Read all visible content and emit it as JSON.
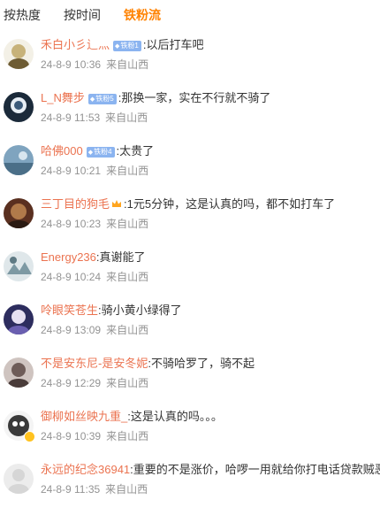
{
  "tabs": [
    {
      "label": "按热度",
      "active": false
    },
    {
      "label": "按时间",
      "active": false
    },
    {
      "label": "铁粉流",
      "active": true
    }
  ],
  "comments": [
    {
      "user": "禾白小彡辶灬",
      "badge": "铁粉1",
      "text": "以后打车吧",
      "time": "24-8-9 10:36",
      "location": "来自山西",
      "avatar_color": "#8a7a54"
    },
    {
      "user": "L_N舞步",
      "badge": "铁粉5",
      "text": "那换一家，实在不行就不骑了",
      "time": "24-8-9 11:53",
      "location": "来自山西",
      "avatar_color": "#203448"
    },
    {
      "user": "哈佛000",
      "badge": "铁粉4",
      "text": "太贵了",
      "time": "24-8-9 10:21",
      "location": "来自山西",
      "avatar_color": "#6a8fa8"
    },
    {
      "user": "三丁目的狗毛",
      "badge": "",
      "text": "1元5分钟，这是认真的吗，都不如打车了",
      "time": "24-8-9 10:23",
      "location": "来自山西",
      "avatar_color": "#8a4a2a"
    },
    {
      "user": "Energy236",
      "badge": "",
      "text": "真谢能了",
      "time": "24-8-9 10:24",
      "location": "来自山西",
      "avatar_color": "#9ab0b8"
    },
    {
      "user": "呤眼笑苍生",
      "badge": "",
      "text": "骑小黄小绿得了",
      "time": "24-8-9 13:09",
      "location": "来自山西",
      "avatar_color": "#3a3a70"
    },
    {
      "user": "不是安东尼-是安冬妮",
      "badge": "",
      "text": "不骑哈罗了，骑不起",
      "time": "24-8-9 12:29",
      "location": "来自山西",
      "avatar_color": "#7a6a6a"
    },
    {
      "user": "御柳如丝映九重_",
      "badge": "",
      "text": "这是认真的吗。。。",
      "time": "24-8-9 10:39",
      "location": "来自山西",
      "avatar_color": "#5a5a5a"
    },
    {
      "user": "永远的纪念36941",
      "badge": "",
      "text": "重要的不是涨价，哈啰一用就给你打电话贷款贼恶心",
      "time": "24-8-9 11:35",
      "location": "来自山西",
      "avatar_color": "#d8d8d8"
    }
  ]
}
